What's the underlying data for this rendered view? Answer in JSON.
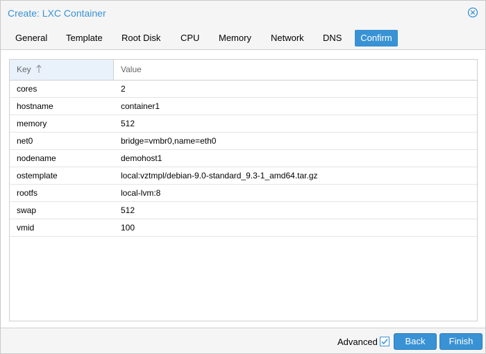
{
  "window": {
    "title": "Create: LXC Container"
  },
  "tabs": [
    {
      "label": "General"
    },
    {
      "label": "Template"
    },
    {
      "label": "Root Disk"
    },
    {
      "label": "CPU"
    },
    {
      "label": "Memory"
    },
    {
      "label": "Network"
    },
    {
      "label": "DNS"
    },
    {
      "label": "Confirm",
      "active": true
    }
  ],
  "grid": {
    "columns": {
      "key": "Key",
      "value": "Value"
    },
    "sort": "ascending",
    "rows": [
      {
        "key": "cores",
        "value": "2"
      },
      {
        "key": "hostname",
        "value": "container1"
      },
      {
        "key": "memory",
        "value": "512"
      },
      {
        "key": "net0",
        "value": "bridge=vmbr0,name=eth0"
      },
      {
        "key": "nodename",
        "value": "demohost1"
      },
      {
        "key": "ostemplate",
        "value": "local:vztmpl/debian-9.0-standard_9.3-1_amd64.tar.gz"
      },
      {
        "key": "rootfs",
        "value": "local-lvm:8"
      },
      {
        "key": "swap",
        "value": "512"
      },
      {
        "key": "vmid",
        "value": "100"
      }
    ]
  },
  "footer": {
    "advanced_label": "Advanced",
    "advanced_checked": true,
    "back_label": "Back",
    "finish_label": "Finish"
  },
  "icons": {
    "close": "close-circle-icon",
    "sort": "sort-ascending-arrow-icon",
    "checkbox": "checkbox-checked-icon"
  },
  "colors": {
    "accent": "#3892d4",
    "header_highlight": "#e9f2fb"
  }
}
